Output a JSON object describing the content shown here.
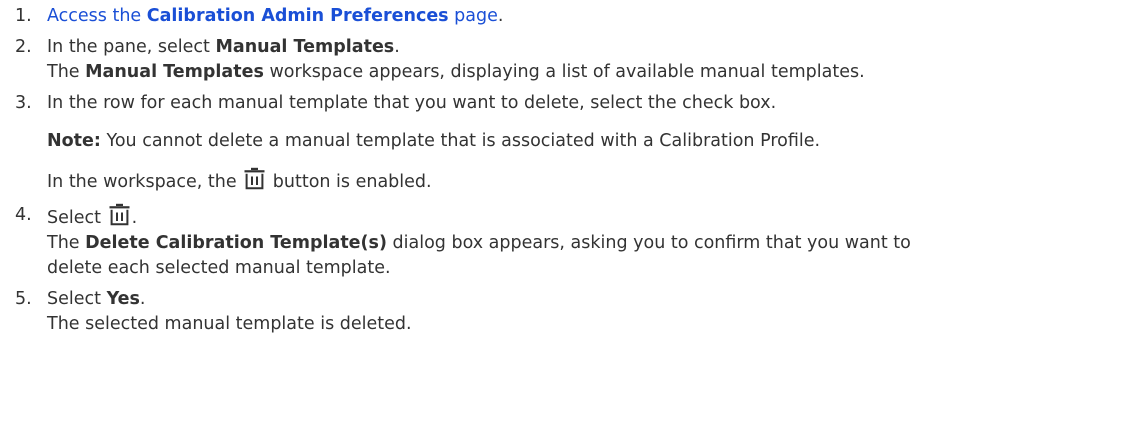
{
  "steps": [
    {
      "num": "1.",
      "link_prefix": "Access the ",
      "link_bold": "Calibration Admin Preferences",
      "link_suffix": " page",
      "end": "."
    },
    {
      "num": "2.",
      "l1_prefix": "In the pane, select ",
      "l1_bold": "Manual Templates",
      "l1_end": ".",
      "l2_prefix": "The ",
      "l2_bold": "Manual Templates",
      "l2_suffix": " workspace appears, displaying a list of available manual templates."
    },
    {
      "num": "3.",
      "l1": "In the row for each manual template that you want to delete, select the check box.",
      "note_label": "Note:",
      "note_text": " You cannot delete a manual template that is associated with a Calibration Profile.",
      "l3_prefix": "In the workspace, the ",
      "l3_suffix": " button is enabled.",
      "icon": "trash-icon"
    },
    {
      "num": "4.",
      "l1_prefix": "Select ",
      "l1_end": ".",
      "l2_prefix": "The ",
      "l2_bold": "Delete Calibration Template(s)",
      "l2_suffix": " dialog box appears, asking you to confirm that you want to",
      "l3": "delete each selected manual template.",
      "icon": "trash-icon"
    },
    {
      "num": "5.",
      "l1_prefix": "Select ",
      "l1_bold": "Yes",
      "l1_end": ".",
      "l2": "The selected manual template is deleted."
    }
  ],
  "colors": {
    "text": "#333333",
    "link": "#1a4fd6"
  }
}
